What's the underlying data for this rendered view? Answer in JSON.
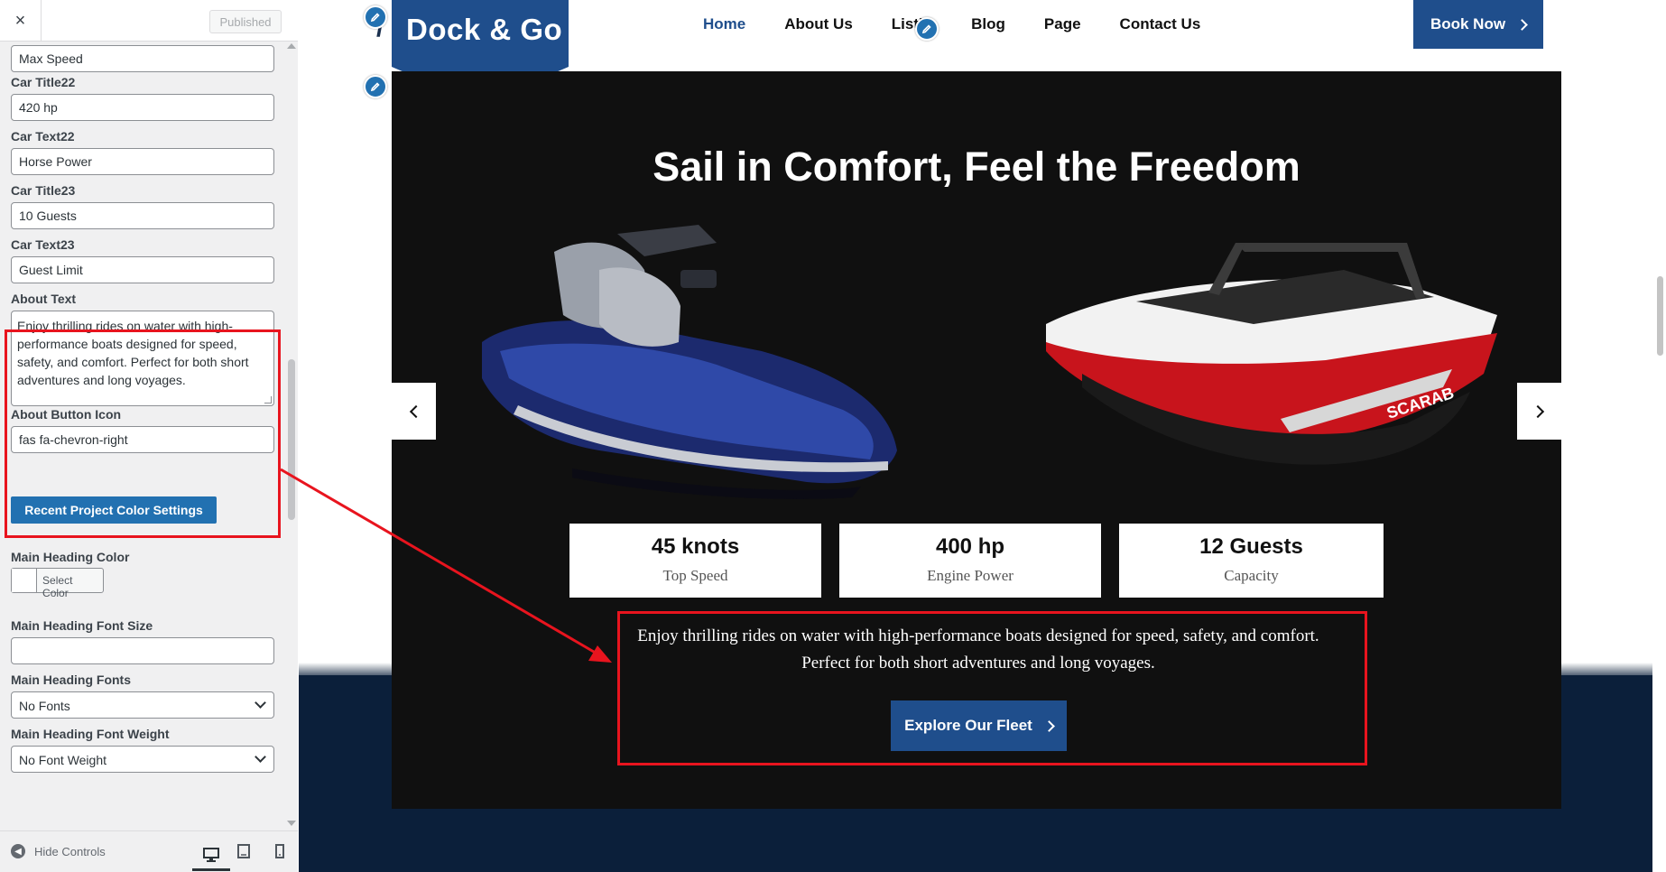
{
  "sidebar": {
    "close_icon": "×",
    "published_label": "Published",
    "fields": [
      {
        "label": "",
        "value": "Max Speed"
      },
      {
        "label": "Car Title22",
        "value": "420 hp"
      },
      {
        "label": "Car Text22",
        "value": "Horse Power"
      },
      {
        "label": "Car Title23",
        "value": "10 Guests"
      },
      {
        "label": "Car Text23",
        "value": "Guest Limit"
      }
    ],
    "about_text_label": "About Text",
    "about_text_value": "Enjoy thrilling rides on water with high-performance boats designed for speed, safety, and comfort. Perfect for both short adventures and long voyages.",
    "about_button_icon_label": "About Button Icon",
    "about_button_icon_value": "fas fa-chevron-right",
    "recent_project_button": "Recent Project Color Settings",
    "main_heading_color_label": "Main Heading Color",
    "select_color_label": "Select Color",
    "main_heading_font_size_label": "Main Heading Font Size",
    "main_heading_font_size_value": "",
    "main_heading_fonts_label": "Main Heading Fonts",
    "main_heading_fonts_value": "No Fonts",
    "main_heading_font_weight_label": "Main Heading Font Weight",
    "main_heading_font_weight_value": "No Font Weight",
    "hide_controls_label": "Hide Controls"
  },
  "preview": {
    "logo": "Dock & Go",
    "nav": [
      "Home",
      "About Us",
      "Listin",
      "Blog",
      "Page",
      "Contact Us"
    ],
    "book_now": "Book Now",
    "hero_heading": "Sail in Comfort, Feel the Freedom",
    "stats": [
      {
        "value": "45 knots",
        "label": "Top Speed"
      },
      {
        "value": "400 hp",
        "label": "Engine Power"
      },
      {
        "value": "12 Guests",
        "label": "Capacity"
      }
    ],
    "about_text": "Enjoy thrilling rides on water with high-performance boats designed for speed, safety, and comfort. Perfect for both short adventures and long voyages.",
    "explore_button": "Explore Our Fleet"
  },
  "colors": {
    "brand_blue": "#1f4e8c",
    "wp_blue": "#2271b1",
    "hero_bg": "#101010",
    "band_navy": "#0b1f3a",
    "annotation_red": "#e8141e"
  }
}
